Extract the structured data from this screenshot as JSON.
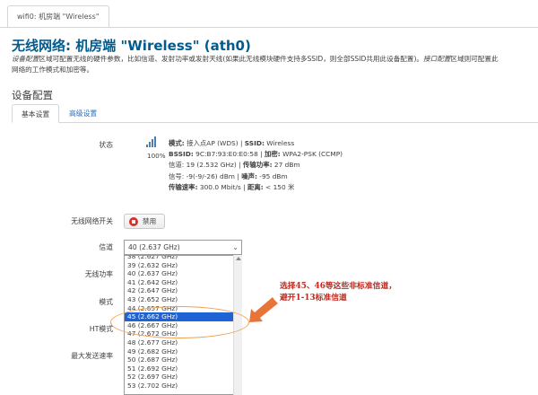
{
  "window_tab": "wifi0: 机房端 \"Wireless\"",
  "page": {
    "title": "无线网络: 机房端 \"Wireless\" (ath0)",
    "description_line1_italic": "设备配置",
    "description_line1_rest": "区域可配置无线的硬件参数，比如信道、发射功率或发射天线(如果此无线模块硬件支持多SSID，则全部SSID共用此设备配置)。",
    "description_line1_italic2": "接口配置",
    "description_line1_tail": "区域则可配置此",
    "description_line2": "网络的工作模式和加密等。"
  },
  "section": {
    "title": "设备配置"
  },
  "tabs": [
    {
      "label": "基本设置"
    },
    {
      "label": "高级设置"
    }
  ],
  "labels": {
    "status": "状态",
    "wireless_switch": "无线网络开关",
    "channel": "信道",
    "tx_power": "无线功率",
    "mode": "模式",
    "ht_mode": "HT模式",
    "max_rate": "最大发送速率"
  },
  "status": {
    "signal_percent": "100%",
    "line1_a_label": "模式:",
    "line1_a_value": " 接入点AP (WDS) | ",
    "line1_b_label": "SSID:",
    "line1_b_value": " Wireless",
    "line2_a_label": "BSSID:",
    "line2_a_value": " 9C:B7:93:E0:E0:58 | ",
    "line2_b_label": "加密:",
    "line2_b_value": " WPA2-PSK (CCMP)",
    "line3_a": "信道: 19 (2.532 GHz) | ",
    "line3_b_label": "传输功率:",
    "line3_b_value": " 27 dBm",
    "line4_a": "信号: -9(-9/-26) dBm | ",
    "line4_b_label": "噪声:",
    "line4_b_value": " -95 dBm",
    "line5_a_label": "传输速率:",
    "line5_a_value": " 300.0 Mbit/s | ",
    "line5_b_label": "距离:",
    "line5_b_value": " < 150 米"
  },
  "disable_button": "禁用",
  "channel_select": {
    "value": "40 (2.637 GHz)"
  },
  "channel_options": [
    "38 (2.627 GHz)",
    "39 (2.632 GHz)",
    "40 (2.637 GHz)",
    "41 (2.642 GHz)",
    "42 (2.647 GHz)",
    "43 (2.652 GHz)",
    "44 (2.657 GHz)",
    "45 (2.662 GHz)",
    "46 (2.667 GHz)",
    "47 (2.672 GHz)",
    "48 (2.677 GHz)",
    "49 (2.682 GHz)",
    "50 (2.687 GHz)",
    "51 (2.692 GHz)",
    "52 (2.697 GHz)",
    "53 (2.702 GHz)"
  ],
  "selected_option_index": 7,
  "annotation": {
    "line1": "选择45、46等这些非标准信道，",
    "line2": "避开1-13标准信道"
  },
  "colors": {
    "title": "#005b8f",
    "selected": "#1e64d7",
    "annotation": "#c0281e",
    "arrow": "#e8743a"
  }
}
